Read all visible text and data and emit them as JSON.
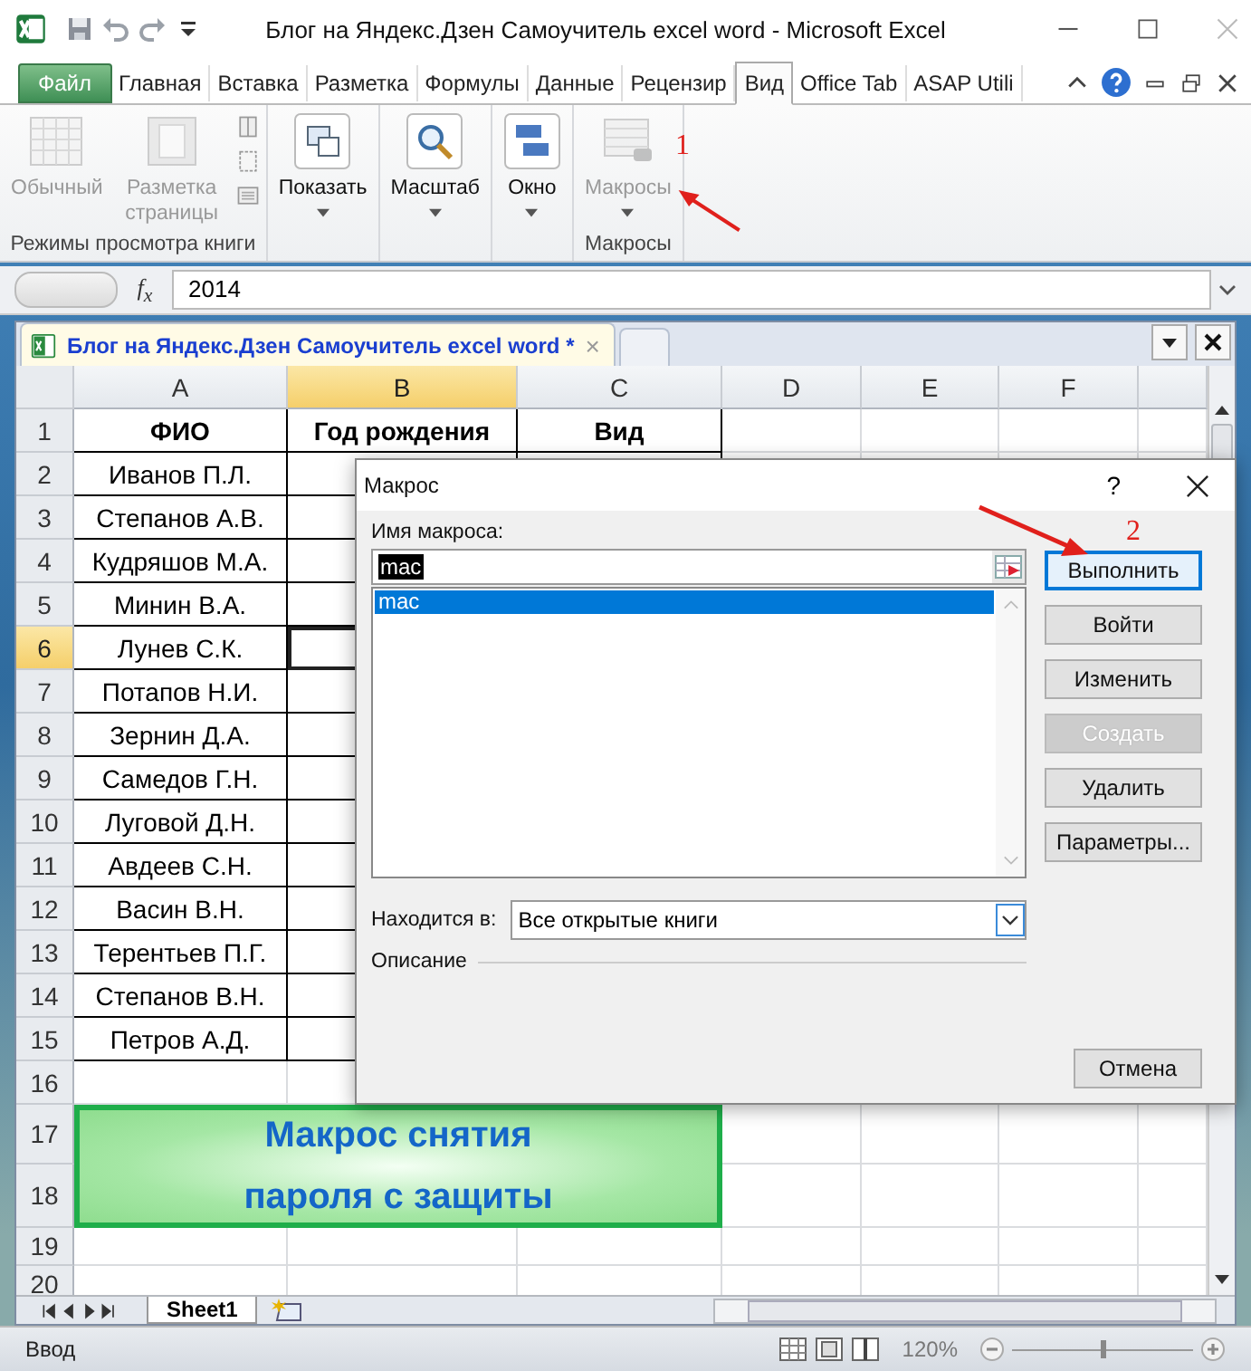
{
  "window": {
    "title": "Блог на Яндекс.Дзен Самоучитель excel word  -  Microsoft Excel"
  },
  "ribbon_tabs": [
    {
      "label": "Файл",
      "kind": "file",
      "selected": false
    },
    {
      "label": "Главная",
      "kind": "tab",
      "selected": false
    },
    {
      "label": "Вставка",
      "kind": "tab",
      "selected": false
    },
    {
      "label": "Разметка",
      "kind": "tab",
      "selected": false
    },
    {
      "label": "Формулы",
      "kind": "tab",
      "selected": false
    },
    {
      "label": "Данные",
      "kind": "tab",
      "selected": false
    },
    {
      "label": "Рецензир",
      "kind": "tab",
      "selected": false
    },
    {
      "label": "Вид",
      "kind": "tab",
      "selected": true
    },
    {
      "label": "Office Tab",
      "kind": "tab",
      "selected": false
    },
    {
      "label": "ASAP Utili",
      "kind": "tab",
      "selected": false
    }
  ],
  "ribbon_groups": [
    {
      "label": "Режимы просмотра книги",
      "buttons": [
        {
          "label": "Обычный",
          "kind": "grid",
          "disabled": true,
          "dropdown": false
        },
        {
          "label": "Разметка страницы",
          "kind": "page",
          "disabled": true,
          "dropdown": false
        }
      ]
    },
    {
      "buttons": [
        {
          "label": "Показать",
          "kind": "show",
          "disabled": false,
          "dropdown": true
        }
      ]
    },
    {
      "buttons": [
        {
          "label": "Масштаб",
          "kind": "zoom",
          "disabled": false,
          "dropdown": true
        }
      ]
    },
    {
      "buttons": [
        {
          "label": "Окно",
          "kind": "window",
          "disabled": false,
          "dropdown": true
        }
      ]
    },
    {
      "label": "Макросы",
      "buttons": [
        {
          "label": "Макросы",
          "kind": "macro",
          "disabled": true,
          "dropdown": true
        }
      ]
    }
  ],
  "annotations": [
    {
      "label": "1"
    },
    {
      "label": "2"
    }
  ],
  "formula_bar": {
    "function_label": "f$_{x}$",
    "value": "2014"
  },
  "workbook_tab": {
    "title": "Блог на Яндекс.Дзен Самоучитель excel word *",
    "close": "×"
  },
  "sheet": {
    "columns": [
      {
        "label": "A",
        "selected": false
      },
      {
        "label": "B",
        "selected": true
      },
      {
        "label": "C",
        "selected": false
      },
      {
        "label": "D",
        "selected": false
      },
      {
        "label": "E",
        "selected": false
      },
      {
        "label": "F",
        "selected": false
      }
    ],
    "rows": [
      {
        "number": "1",
        "selected": false,
        "cells": [
          "ФИО",
          "Год рождения",
          "Вид"
        ]
      },
      {
        "number": "2",
        "selected": false,
        "cells": [
          "Иванов П.Л."
        ]
      },
      {
        "number": "3",
        "selected": false,
        "cells": [
          "Степанов А.В."
        ]
      },
      {
        "number": "4",
        "selected": false,
        "cells": [
          "Кудряшов М.А."
        ]
      },
      {
        "number": "5",
        "selected": false,
        "cells": [
          "Минин В.А."
        ]
      },
      {
        "number": "6",
        "selected": true,
        "cells": [
          "Лунев С.К."
        ]
      },
      {
        "number": "7",
        "selected": false,
        "cells": [
          "Потапов Н.И."
        ]
      },
      {
        "number": "8",
        "selected": false,
        "cells": [
          "Зернин Д.А."
        ]
      },
      {
        "number": "9",
        "selected": false,
        "cells": [
          "Самедов Г.Н."
        ]
      },
      {
        "number": "10",
        "selected": false,
        "cells": [
          "Луговой Д.Н."
        ]
      },
      {
        "number": "11",
        "selected": false,
        "cells": [
          "Авдеев С.Н."
        ]
      },
      {
        "number": "12",
        "selected": false,
        "cells": [
          "Васин В.Н."
        ]
      },
      {
        "number": "13",
        "selected": false,
        "cells": [
          "Терентьев П.Г."
        ]
      },
      {
        "number": "14",
        "selected": false,
        "cells": [
          "Степанов В.Н."
        ]
      },
      {
        "number": "15",
        "selected": false,
        "cells": [
          "Петров А.Д."
        ]
      },
      {
        "number": "16",
        "selected": false
      },
      {
        "number": "17",
        "selected": false
      },
      {
        "number": "18",
        "selected": false
      },
      {
        "number": "19",
        "selected": false
      },
      {
        "number": "20",
        "selected": false
      }
    ],
    "banner": {
      "text": "Макрос снятия пароля с защиты"
    }
  },
  "sheet_tabs": [
    {
      "label": "Sheet1",
      "selected": true
    }
  ],
  "status_bar": {
    "mode": "Ввод",
    "zoom": "120%",
    "zoom_slider": {
      "level": 0.5
    }
  },
  "dialog": {
    "title": "Макрос",
    "help": "?",
    "name_label": "Имя макроса:",
    "name_value": "mac",
    "macros": [
      {
        "label": "mac",
        "selected": true
      }
    ],
    "buttons": [
      {
        "label": "Выполнить",
        "default": true,
        "disabled": false
      },
      {
        "label": "Войти",
        "default": false,
        "disabled": false
      },
      {
        "label": "Изменить",
        "default": false,
        "disabled": false
      },
      {
        "label": "Создать",
        "default": false,
        "disabled": true
      },
      {
        "label": "Удалить",
        "default": false,
        "disabled": false
      },
      {
        "label": "Параметры...",
        "default": false,
        "disabled": false
      }
    ],
    "location_label": "Находится в:",
    "location_value": "Все открытые книги",
    "description_label": "Описание",
    "cancel": "Отмена"
  }
}
